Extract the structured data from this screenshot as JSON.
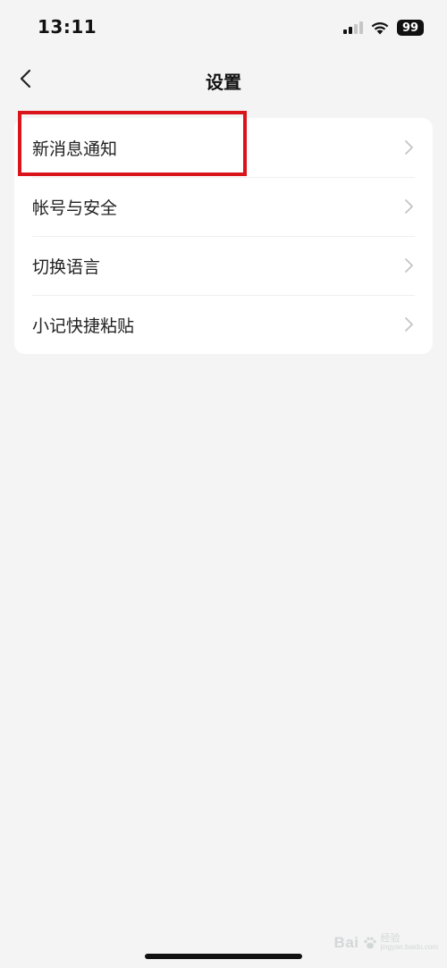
{
  "status_bar": {
    "time": "13:11",
    "battery_level": "99",
    "signal_bars": 2,
    "signal_bars_total": 4
  },
  "nav": {
    "title": "设置",
    "back_icon": "chevron-left-icon"
  },
  "settings": {
    "items": [
      {
        "label": "新消息通知",
        "icon": "chevron-right-icon"
      },
      {
        "label": "帐号与安全",
        "icon": "chevron-right-icon"
      },
      {
        "label": "切换语言",
        "icon": "chevron-right-icon"
      },
      {
        "label": "小记快捷粘贴",
        "icon": "chevron-right-icon"
      }
    ]
  },
  "annotation": {
    "highlighted_item": "新消息通知",
    "color": "#d9141a"
  },
  "watermark": {
    "brand": "Bai",
    "sub": "经验",
    "url": "jingyan.baidu.com"
  },
  "colors": {
    "background": "#f3f4f3",
    "card": "#ffffff",
    "text": "#222222",
    "chevron": "#c4c4c4"
  }
}
